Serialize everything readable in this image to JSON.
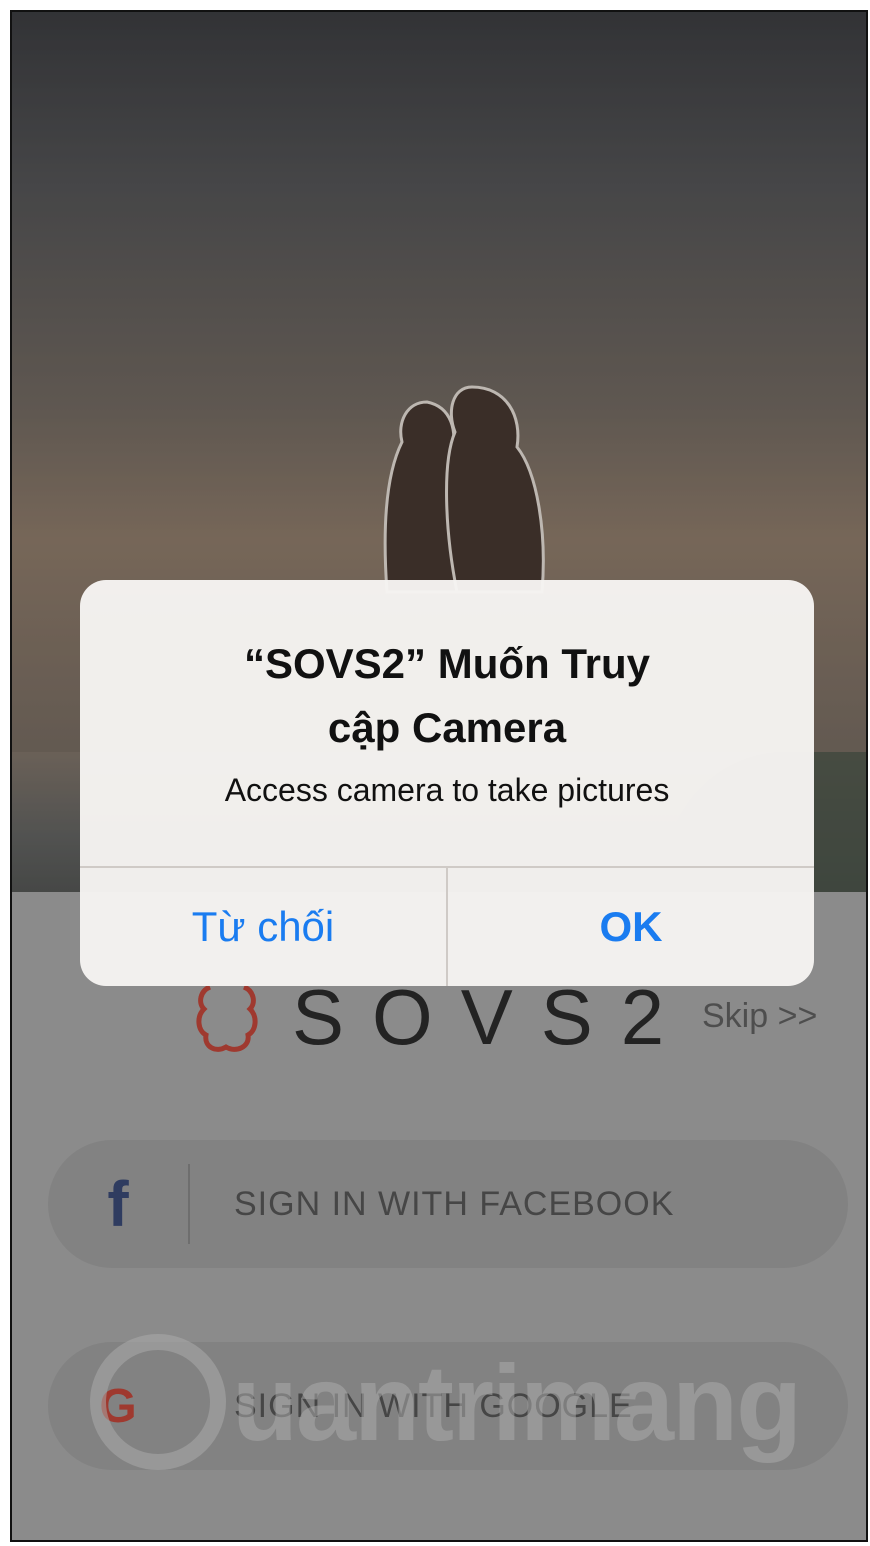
{
  "dialog": {
    "title": "“SOVS2” Muốn Truy cập Camera",
    "message": "Access camera to take pictures",
    "deny_label": "Từ chối",
    "ok_label": "OK"
  },
  "app": {
    "brand": "SOVS2",
    "skip_label": "Skip >>",
    "facebook_label": "SIGN IN WITH FACEBOOK",
    "facebook_glyph": "f",
    "google_label": "SIGN IN WITH GOOGLE",
    "google_glyph": "G"
  },
  "watermark": {
    "text": "uantrimang"
  },
  "colors": {
    "accent": "#1a7cf0",
    "facebook": "#2b3d6c",
    "google": "#c0392b",
    "logo": "#c0392b"
  }
}
